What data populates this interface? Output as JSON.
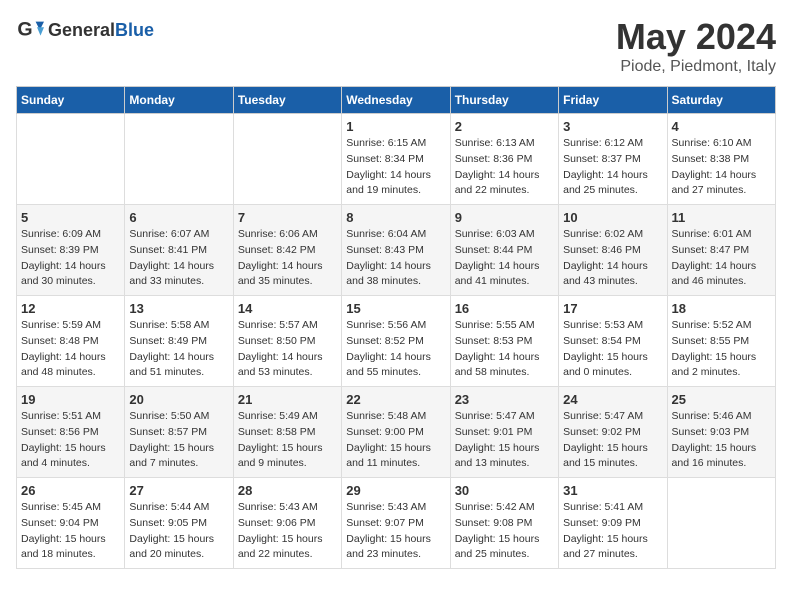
{
  "logo": {
    "general": "General",
    "blue": "Blue"
  },
  "title": "May 2024",
  "subtitle": "Piode, Piedmont, Italy",
  "days_of_week": [
    "Sunday",
    "Monday",
    "Tuesday",
    "Wednesday",
    "Thursday",
    "Friday",
    "Saturday"
  ],
  "weeks": [
    [
      {
        "day": "",
        "info": ""
      },
      {
        "day": "",
        "info": ""
      },
      {
        "day": "",
        "info": ""
      },
      {
        "day": "1",
        "info": "Sunrise: 6:15 AM\nSunset: 8:34 PM\nDaylight: 14 hours\nand 19 minutes."
      },
      {
        "day": "2",
        "info": "Sunrise: 6:13 AM\nSunset: 8:36 PM\nDaylight: 14 hours\nand 22 minutes."
      },
      {
        "day": "3",
        "info": "Sunrise: 6:12 AM\nSunset: 8:37 PM\nDaylight: 14 hours\nand 25 minutes."
      },
      {
        "day": "4",
        "info": "Sunrise: 6:10 AM\nSunset: 8:38 PM\nDaylight: 14 hours\nand 27 minutes."
      }
    ],
    [
      {
        "day": "5",
        "info": "Sunrise: 6:09 AM\nSunset: 8:39 PM\nDaylight: 14 hours\nand 30 minutes."
      },
      {
        "day": "6",
        "info": "Sunrise: 6:07 AM\nSunset: 8:41 PM\nDaylight: 14 hours\nand 33 minutes."
      },
      {
        "day": "7",
        "info": "Sunrise: 6:06 AM\nSunset: 8:42 PM\nDaylight: 14 hours\nand 35 minutes."
      },
      {
        "day": "8",
        "info": "Sunrise: 6:04 AM\nSunset: 8:43 PM\nDaylight: 14 hours\nand 38 minutes."
      },
      {
        "day": "9",
        "info": "Sunrise: 6:03 AM\nSunset: 8:44 PM\nDaylight: 14 hours\nand 41 minutes."
      },
      {
        "day": "10",
        "info": "Sunrise: 6:02 AM\nSunset: 8:46 PM\nDaylight: 14 hours\nand 43 minutes."
      },
      {
        "day": "11",
        "info": "Sunrise: 6:01 AM\nSunset: 8:47 PM\nDaylight: 14 hours\nand 46 minutes."
      }
    ],
    [
      {
        "day": "12",
        "info": "Sunrise: 5:59 AM\nSunset: 8:48 PM\nDaylight: 14 hours\nand 48 minutes."
      },
      {
        "day": "13",
        "info": "Sunrise: 5:58 AM\nSunset: 8:49 PM\nDaylight: 14 hours\nand 51 minutes."
      },
      {
        "day": "14",
        "info": "Sunrise: 5:57 AM\nSunset: 8:50 PM\nDaylight: 14 hours\nand 53 minutes."
      },
      {
        "day": "15",
        "info": "Sunrise: 5:56 AM\nSunset: 8:52 PM\nDaylight: 14 hours\nand 55 minutes."
      },
      {
        "day": "16",
        "info": "Sunrise: 5:55 AM\nSunset: 8:53 PM\nDaylight: 14 hours\nand 58 minutes."
      },
      {
        "day": "17",
        "info": "Sunrise: 5:53 AM\nSunset: 8:54 PM\nDaylight: 15 hours\nand 0 minutes."
      },
      {
        "day": "18",
        "info": "Sunrise: 5:52 AM\nSunset: 8:55 PM\nDaylight: 15 hours\nand 2 minutes."
      }
    ],
    [
      {
        "day": "19",
        "info": "Sunrise: 5:51 AM\nSunset: 8:56 PM\nDaylight: 15 hours\nand 4 minutes."
      },
      {
        "day": "20",
        "info": "Sunrise: 5:50 AM\nSunset: 8:57 PM\nDaylight: 15 hours\nand 7 minutes."
      },
      {
        "day": "21",
        "info": "Sunrise: 5:49 AM\nSunset: 8:58 PM\nDaylight: 15 hours\nand 9 minutes."
      },
      {
        "day": "22",
        "info": "Sunrise: 5:48 AM\nSunset: 9:00 PM\nDaylight: 15 hours\nand 11 minutes."
      },
      {
        "day": "23",
        "info": "Sunrise: 5:47 AM\nSunset: 9:01 PM\nDaylight: 15 hours\nand 13 minutes."
      },
      {
        "day": "24",
        "info": "Sunrise: 5:47 AM\nSunset: 9:02 PM\nDaylight: 15 hours\nand 15 minutes."
      },
      {
        "day": "25",
        "info": "Sunrise: 5:46 AM\nSunset: 9:03 PM\nDaylight: 15 hours\nand 16 minutes."
      }
    ],
    [
      {
        "day": "26",
        "info": "Sunrise: 5:45 AM\nSunset: 9:04 PM\nDaylight: 15 hours\nand 18 minutes."
      },
      {
        "day": "27",
        "info": "Sunrise: 5:44 AM\nSunset: 9:05 PM\nDaylight: 15 hours\nand 20 minutes."
      },
      {
        "day": "28",
        "info": "Sunrise: 5:43 AM\nSunset: 9:06 PM\nDaylight: 15 hours\nand 22 minutes."
      },
      {
        "day": "29",
        "info": "Sunrise: 5:43 AM\nSunset: 9:07 PM\nDaylight: 15 hours\nand 23 minutes."
      },
      {
        "day": "30",
        "info": "Sunrise: 5:42 AM\nSunset: 9:08 PM\nDaylight: 15 hours\nand 25 minutes."
      },
      {
        "day": "31",
        "info": "Sunrise: 5:41 AM\nSunset: 9:09 PM\nDaylight: 15 hours\nand 27 minutes."
      },
      {
        "day": "",
        "info": ""
      }
    ]
  ]
}
